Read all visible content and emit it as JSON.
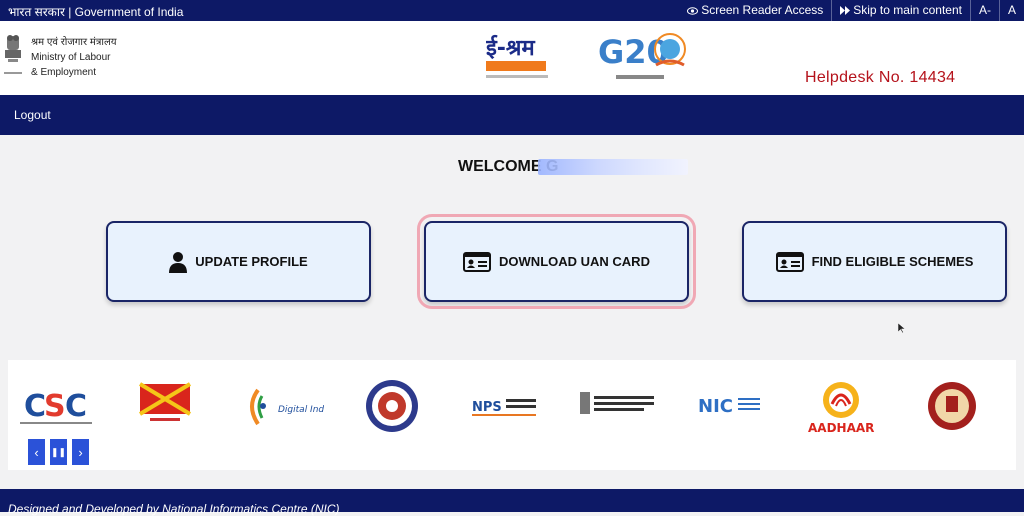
{
  "topbar": {
    "gov_label": "भारत सरकार | Government of India",
    "screen_reader": "Screen Reader Access",
    "skip_main": "Skip to main content",
    "font_decrease": "A-",
    "font_normal": "A"
  },
  "header": {
    "ministry_hindi": "श्रम एवं रोजगार मंत्रालय",
    "ministry_line1": "Ministry of Labour",
    "ministry_line2": "& Employment",
    "eshram_logo": "ई-श्रम",
    "g20_logo": "G20",
    "helpdesk": "Helpdesk No. 14434"
  },
  "nav": {
    "logout": "Logout"
  },
  "main": {
    "welcome": "WELCOME G",
    "cards": [
      {
        "label": "UPDATE PROFILE",
        "icon": "user-icon"
      },
      {
        "label": "DOWNLOAD UAN CARD",
        "icon": "id-card-icon"
      },
      {
        "label": "FIND ELIGIBLE SCHEMES",
        "icon": "id-card-icon"
      }
    ]
  },
  "partners": {
    "logos": [
      "CSC",
      "India Post",
      "Digital India",
      "EPFO",
      "NPS",
      "Ministry of Labour & Employment",
      "NIC",
      "AADHAAR",
      "ESIC"
    ],
    "controls": {
      "prev": "‹",
      "pause": "❚❚",
      "next": "›"
    }
  },
  "footer": {
    "text": "Designed and Developed by National Informatics Centre (NIC)"
  },
  "colors": {
    "navy": "#0d1966",
    "helpdesk_red": "#b5121b",
    "card_bg": "#e8f2fd",
    "highlight": "#f0a8b4",
    "control_blue": "#2b52d8"
  }
}
